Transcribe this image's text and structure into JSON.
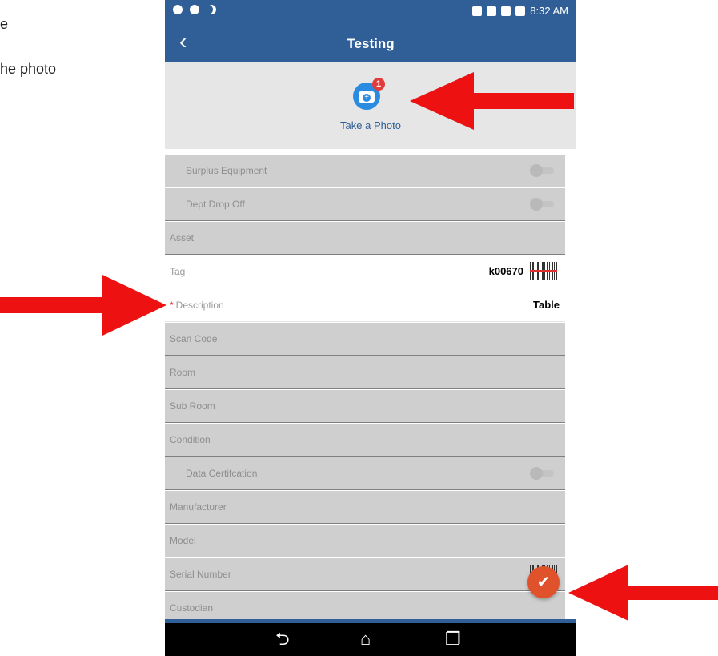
{
  "doc": {
    "line1": "e",
    "line2": "he photo"
  },
  "status_bar": {
    "time": "8:32 AM"
  },
  "header": {
    "back_glyph": "‹",
    "title": "Testing"
  },
  "photo": {
    "label": "Take a Photo",
    "badge_count": "1",
    "icon": "camera-plus-icon"
  },
  "rows": [
    {
      "label": "Surplus Equipment",
      "type": "toggle",
      "indent": true
    },
    {
      "label": "Dept Drop Off",
      "type": "toggle",
      "indent": true
    },
    {
      "label": "Asset",
      "type": "plain"
    },
    {
      "label": "Tag",
      "value": "k00670",
      "type": "barcode",
      "active": true
    },
    {
      "label": "Description",
      "value": "Table",
      "required": true,
      "active": true
    },
    {
      "label": "Scan Code",
      "type": "plain"
    },
    {
      "label": "Room",
      "type": "plain"
    },
    {
      "label": "Sub Room",
      "type": "plain"
    },
    {
      "label": "Condition",
      "type": "plain"
    },
    {
      "label": "Data Certifcation",
      "type": "toggle",
      "indent": true
    },
    {
      "label": "Manufacturer",
      "type": "plain"
    },
    {
      "label": "Model",
      "type": "plain"
    },
    {
      "label": "Serial Number",
      "type": "barcode"
    },
    {
      "label": "Custodian",
      "type": "plain"
    }
  ],
  "fab": {
    "icon": "checkmark-icon",
    "glyph": "✔"
  },
  "navbar": {
    "back_glyph": "⮌",
    "home_glyph": "⌂",
    "recents_glyph": "❐"
  },
  "colors": {
    "appbar": "#2f5f96",
    "fab": "#e0522c",
    "arrow": "#ee1111"
  }
}
